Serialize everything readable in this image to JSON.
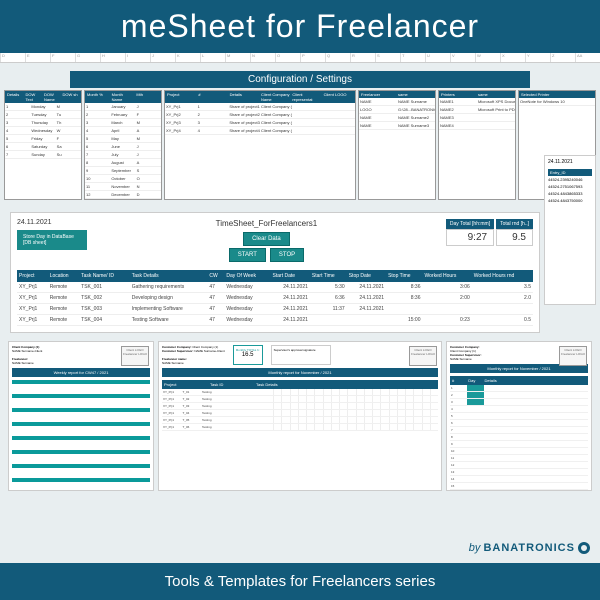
{
  "header": {
    "title": "meSheet for Freelancer"
  },
  "config": {
    "title": "Configuration / Settings",
    "panels": [
      {
        "heads": [
          "Details",
          "DOW Text",
          "DOW Name",
          "DOW sh"
        ],
        "rows": [
          [
            "1",
            "Monday",
            "M"
          ],
          [
            "2",
            "Tuesday",
            "Tu"
          ],
          [
            "3",
            "Thursday",
            "Th"
          ],
          [
            "4",
            "Wednesday",
            "W"
          ],
          [
            "5",
            "Friday",
            "F"
          ],
          [
            "6",
            "Saturday",
            "Sa"
          ],
          [
            "7",
            "Sunday",
            "Su"
          ]
        ]
      },
      {
        "heads": [
          "Month %",
          "Month Name",
          "Mth"
        ],
        "rows": [
          [
            "1",
            "January",
            "J"
          ],
          [
            "2",
            "February",
            "F"
          ],
          [
            "3",
            "March",
            "M"
          ],
          [
            "4",
            "April",
            "A"
          ],
          [
            "5",
            "May",
            "M"
          ],
          [
            "6",
            "June",
            "J"
          ],
          [
            "7",
            "July",
            "J"
          ],
          [
            "8",
            "August",
            "A"
          ],
          [
            "9",
            "September",
            "S"
          ],
          [
            "10",
            "October",
            "O"
          ],
          [
            "11",
            "November",
            "N"
          ],
          [
            "12",
            "December",
            "D"
          ]
        ]
      },
      {
        "heads": [
          "Project",
          "#",
          "Details",
          "Client Company Name",
          "Client representat",
          "Client LOGO"
        ],
        "rows": [
          [
            "XY_Prj1",
            "1",
            "Share of project1",
            "Client Company (1)",
            "",
            ""
          ],
          [
            "XY_Prj2",
            "2",
            "Share of project2",
            "Client Company (2)",
            "",
            ""
          ],
          [
            "XY_Prj3",
            "3",
            "Share of project3",
            "Client Company (3)",
            "",
            ""
          ],
          [
            "XY_Prj4",
            "4",
            "Share of project4",
            "Client Company (4)",
            "",
            ""
          ]
        ]
      },
      {
        "heads": [
          "Freelancer",
          "same"
        ],
        "rows": [
          [
            "NAME",
            "NAME Surname"
          ],
          [
            "LOGO",
            "G:\\28...BANATRONICS"
          ],
          [
            "NAME",
            "NAME Surname2"
          ],
          [
            "NAME",
            "NAME Surname3"
          ]
        ]
      },
      {
        "heads": [
          "Printers",
          "same"
        ],
        "rows": [
          [
            "NAME1",
            "Microsoft XPS Document Writer"
          ],
          [
            "NAME2",
            "Microsoft Print to PDF"
          ],
          [
            "NAME3",
            ""
          ],
          [
            "NAME4",
            ""
          ]
        ]
      },
      {
        "heads": [
          "Selected Printer"
        ],
        "rows": [
          [
            "OneNote for Windows 10"
          ]
        ]
      }
    ]
  },
  "mainsheet": {
    "date": "24.11.2021",
    "title": "TimeSheet_ForFreelancers1",
    "store_btn": "Store Day in DataBase [DB sheet]",
    "clear_btn": "Clear Data",
    "start_btn": "START",
    "stop_btn": "STOP",
    "tot1_label": "Day Total [hh:mm]",
    "tot2_label": "Total rnd [h..]",
    "tot1_val": "9:27",
    "tot2_val": "9.5",
    "cols": [
      "Project",
      "Location",
      "Task Name/ ID",
      "Task Details",
      "CW",
      "Day Of Week",
      "Start Date",
      "Start Time",
      "Stop Date",
      "Stop Time",
      "Worked Hours",
      "Worked Hours rnd"
    ],
    "rows": [
      [
        "XY_Prj1",
        "Remote",
        "TSK_001",
        "Gathering requirements",
        "47",
        "Wednesday",
        "24.11.2021",
        "5:30",
        "24.11.2021",
        "8:36",
        "3:06",
        "3.5"
      ],
      [
        "XY_Prj1",
        "Remote",
        "TSK_002",
        "Developing design",
        "47",
        "Wednesday",
        "24.11.2021",
        "6:36",
        "24.11.2021",
        "8:36",
        "2:00",
        "2.0"
      ],
      [
        "XY_Prj1",
        "Remote",
        "TSK_003",
        "Implementing Software",
        "47",
        "Wednesday",
        "24.11.2021",
        "11:37",
        "24.11.2021",
        "",
        "",
        ""
      ],
      [
        "XY_Prj1",
        "Remote",
        "TSK_004",
        "Testing Software",
        "47",
        "Wednesday",
        "24.11.2021",
        "",
        "",
        "15:00",
        "0:23",
        "0.5"
      ]
    ],
    "side_date": "24.11.2021",
    "entry_label": "Entry_ID",
    "entries": [
      "44524.2395240046",
      "44524.2751067593",
      "44524.4843865333",
      "44524.4843750000"
    ]
  },
  "thumbs": {
    "logo_client": "Client LOGO",
    "logo_freelancer": "Freelancer LOGO",
    "t1": {
      "cust": "Client Company (1)",
      "rep": "NAME Surname-Client",
      "freelancer": "NAME Surname",
      "bar": "Weekly report for CW47 / 2021"
    },
    "t2": {
      "cust": "Client Company (1)",
      "rep": "NAME Surname-Client",
      "sup": "NAME Surname",
      "total_label": "Monthly TOTAL h:",
      "total": "16.5",
      "sig": "Supervisor's approval signature",
      "bar": "Monthly report for November / 2021",
      "cols": [
        "Project",
        "Task ID",
        "Task Details"
      ],
      "rows": [
        [
          "XY_Prj1",
          "T_01",
          "Testing"
        ],
        [
          "XY_Prj1",
          "T_02",
          "Testing"
        ],
        [
          "XY_Prj1",
          "T_03",
          "Testing"
        ],
        [
          "XY_Prj1",
          "T_04",
          "Testing"
        ],
        [
          "XY_Prj1",
          "T_05",
          "Testing"
        ],
        [
          "XY_Prj1",
          "T_06",
          "Testing"
        ]
      ]
    },
    "t3": {
      "cust": "Client Company (1)",
      "rep": "NAME Surname",
      "bar": "Monthly report for November / 2021",
      "freelancer": "P. Freelancer",
      "notes": "Freelancer's notes",
      "cols": [
        "Day",
        "Details"
      ]
    }
  },
  "brand": {
    "by": "by",
    "name": "BANATRONICS"
  },
  "footer": {
    "text": "Tools & Templates for Freelancers series"
  }
}
